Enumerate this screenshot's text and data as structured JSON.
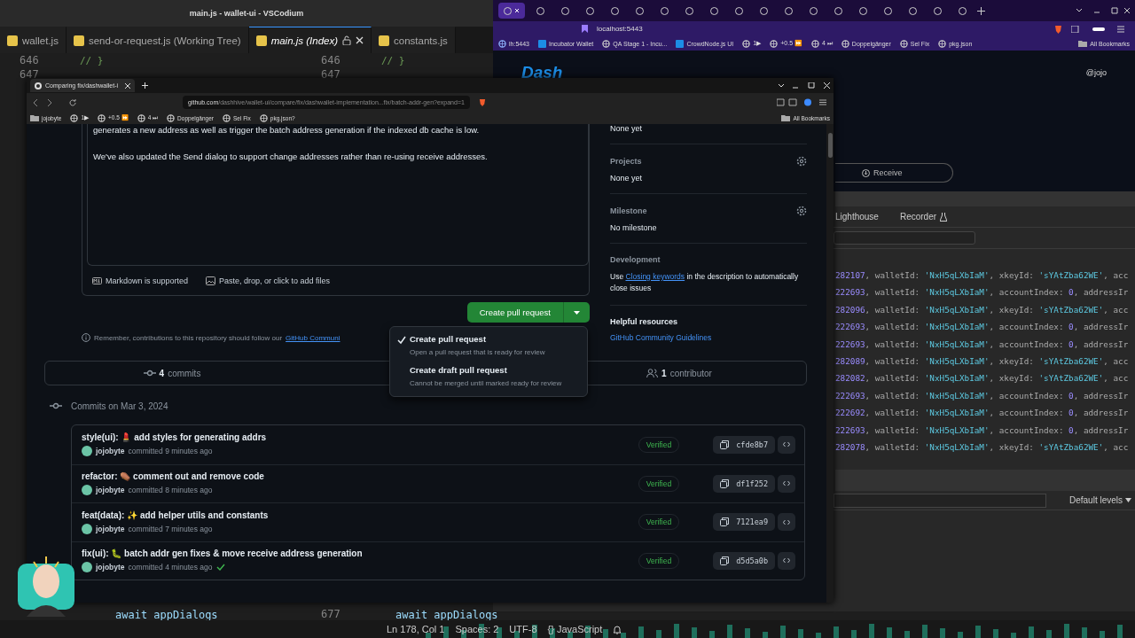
{
  "editor": {
    "title": "main.js - wallet-ui - VSCodium",
    "tabs": [
      {
        "label": "wallet.js",
        "selected": false
      },
      {
        "label": "send-or-request.js (Working Tree)",
        "selected": false
      },
      {
        "label": "main.js (Index)",
        "selected": true
      },
      {
        "label": "constants.js",
        "selected": false
      }
    ],
    "panes": [
      {
        "top_lines": [
          {
            "number": "646",
            "code": "// }"
          },
          {
            "number": "647"
          }
        ],
        "bottom_code": "await appDialogs"
      },
      {
        "top_lines": [
          {
            "number": "646",
            "code": "// }"
          },
          {
            "number": "647"
          }
        ],
        "bottom_number": "677",
        "bottom_code": "await appDialogs"
      }
    ],
    "status": [
      "Ln 178, Col 1",
      "Spaces: 2",
      "UTF-8",
      "{} JavaScript"
    ]
  },
  "brave": {
    "tabs": [
      {
        "selected": true
      },
      {
        "selected": false
      },
      {
        "selected": false
      },
      {
        "selected": false
      },
      {
        "selected": false
      },
      {
        "selected": false
      },
      {
        "selected": false
      },
      {
        "selected": false
      },
      {
        "selected": false
      },
      {
        "selected": false
      },
      {
        "selected": false
      },
      {
        "selected": false
      },
      {
        "selected": false
      },
      {
        "selected": false
      },
      {
        "selected": false
      },
      {
        "selected": false
      },
      {
        "selected": false
      },
      {
        "selected": false
      },
      {
        "selected": false
      }
    ],
    "url": "localhost:5443",
    "bookmarks": [
      {
        "label": "lh:5443",
        "kind": "site"
      },
      {
        "label": "Incubator Wallet",
        "kind": "app"
      },
      {
        "label": "QA Stage 1 - Incu...",
        "kind": "globe"
      },
      {
        "label": "CrowdNode.js UI",
        "kind": "app"
      },
      {
        "label": "1▶",
        "kind": "globe"
      },
      {
        "label": "+0.5 ⏩",
        "kind": "globe"
      },
      {
        "label": "4 ⏭",
        "kind": "globe"
      },
      {
        "label": "Doppelgänger",
        "kind": "globe"
      },
      {
        "label": "Sel Fix",
        "kind": "globe"
      },
      {
        "label": "pkg.json",
        "kind": "globe"
      }
    ],
    "all_bookmarks": "All Bookmarks",
    "page": {
      "logo": "Dash",
      "user": "@jojo",
      "receive": "Receive"
    },
    "devtools": {
      "tabs": [
        "Lighthouse",
        "Recorder"
      ],
      "console": [
        [
          {
            "text": "282107",
            "kind": "number"
          },
          {
            "text": ", walletId: ",
            "kind": "plain"
          },
          {
            "text": "'NxH5qLXbIaM'",
            "kind": "string"
          },
          {
            "text": ", xkeyId: ",
            "kind": "plain"
          },
          {
            "text": "'sYAtZba62WE'",
            "kind": "string"
          },
          {
            "text": ", acc",
            "kind": "plain"
          }
        ],
        [
          {
            "text": "222693",
            "kind": "number"
          },
          {
            "text": ", walletId: ",
            "kind": "plain"
          },
          {
            "text": "'NxH5qLXbIaM'",
            "kind": "string"
          },
          {
            "text": ", accountIndex: ",
            "kind": "plain"
          },
          {
            "text": "0",
            "kind": "number"
          },
          {
            "text": ", addressIr",
            "kind": "plain"
          }
        ],
        [
          {
            "text": "282096",
            "kind": "number"
          },
          {
            "text": ", walletId: ",
            "kind": "plain"
          },
          {
            "text": "'NxH5qLXbIaM'",
            "kind": "string"
          },
          {
            "text": ", xkeyId: ",
            "kind": "plain"
          },
          {
            "text": "'sYAtZba62WE'",
            "kind": "string"
          },
          {
            "text": ", acc",
            "kind": "plain"
          }
        ],
        [
          {
            "text": "222693",
            "kind": "number"
          },
          {
            "text": ", walletId: ",
            "kind": "plain"
          },
          {
            "text": "'NxH5qLXbIaM'",
            "kind": "string"
          },
          {
            "text": ", accountIndex: ",
            "kind": "plain"
          },
          {
            "text": "0",
            "kind": "number"
          },
          {
            "text": ", addressIr",
            "kind": "plain"
          }
        ],
        [
          {
            "text": "222693",
            "kind": "number"
          },
          {
            "text": ", walletId: ",
            "kind": "plain"
          },
          {
            "text": "'NxH5qLXbIaM'",
            "kind": "string"
          },
          {
            "text": ", accountIndex: ",
            "kind": "plain"
          },
          {
            "text": "0",
            "kind": "number"
          },
          {
            "text": ", addressIr",
            "kind": "plain"
          }
        ],
        [
          {
            "text": "282089",
            "kind": "number"
          },
          {
            "text": ", walletId: ",
            "kind": "plain"
          },
          {
            "text": "'NxH5qLXbIaM'",
            "kind": "string"
          },
          {
            "text": ", xkeyId: ",
            "kind": "plain"
          },
          {
            "text": "'sYAtZba62WE'",
            "kind": "string"
          },
          {
            "text": ", acc",
            "kind": "plain"
          }
        ],
        [
          {
            "text": "282082",
            "kind": "number"
          },
          {
            "text": ", walletId: ",
            "kind": "plain"
          },
          {
            "text": "'NxH5qLXbIaM'",
            "kind": "string"
          },
          {
            "text": ", xkeyId: ",
            "kind": "plain"
          },
          {
            "text": "'sYAtZba62WE'",
            "kind": "string"
          },
          {
            "text": ", acc",
            "kind": "plain"
          }
        ],
        [
          {
            "text": "222693",
            "kind": "number"
          },
          {
            "text": ", walletId: ",
            "kind": "plain"
          },
          {
            "text": "'NxH5qLXbIaM'",
            "kind": "string"
          },
          {
            "text": ", accountIndex: ",
            "kind": "plain"
          },
          {
            "text": "0",
            "kind": "number"
          },
          {
            "text": ", addressIr",
            "kind": "plain"
          }
        ],
        [
          {
            "text": "222692",
            "kind": "number"
          },
          {
            "text": ", walletId: ",
            "kind": "plain"
          },
          {
            "text": "'NxH5qLXbIaM'",
            "kind": "string"
          },
          {
            "text": ", accountIndex: ",
            "kind": "plain"
          },
          {
            "text": "0",
            "kind": "number"
          },
          {
            "text": ", addressIr",
            "kind": "plain"
          }
        ],
        [
          {
            "text": "222693",
            "kind": "number"
          },
          {
            "text": ", walletId: ",
            "kind": "plain"
          },
          {
            "text": "'NxH5qLXbIaM'",
            "kind": "string"
          },
          {
            "text": ", accountIndex: ",
            "kind": "plain"
          },
          {
            "text": "0",
            "kind": "number"
          },
          {
            "text": ", addressIr",
            "kind": "plain"
          }
        ],
        [
          {
            "text": "282078",
            "kind": "number"
          },
          {
            "text": ", walletId: ",
            "kind": "plain"
          },
          {
            "text": "'NxH5qLXbIaM'",
            "kind": "string"
          },
          {
            "text": ", xkeyId: ",
            "kind": "plain"
          },
          {
            "text": "'sYAtZba62WE'",
            "kind": "string"
          },
          {
            "text": ", acc",
            "kind": "plain"
          }
        ]
      ],
      "levels": "Default levels"
    }
  },
  "github": {
    "tab_title": "Comparing fix/dashwallet-i",
    "url_host": "github.com",
    "url_path": "/dashhive/wallet-ui/compare/fix/dashwallet-implementation...fix/batch-addr-gen?expand=1",
    "bookmarks": [
      {
        "label": "jojobyte",
        "kind": "folder"
      },
      {
        "label": "1▶",
        "kind": "globe"
      },
      {
        "label": "+0.5 ⏩",
        "kind": "globe"
      },
      {
        "label": "4 ⏭",
        "kind": "globe"
      },
      {
        "label": "Doppelgänger",
        "kind": "globe"
      },
      {
        "label": "Sel Fix",
        "kind": "globe"
      },
      {
        "label": "pkg.json?",
        "kind": "globe"
      }
    ],
    "all_bookmarks": "All Bookmarks",
    "description": [
      "generates a new address as well as trigger the batch address generation if the indexed db cache is low.",
      "We've also updated the Send dialog to support change addresses rather than re-using receive addresses."
    ],
    "markdown_note": "Markdown is supported",
    "attach_note": "Paste, drop, or click to add files",
    "create_button": "Create pull request",
    "menu": [
      {
        "title": "Create pull request",
        "description": "Open a pull request that is ready for review",
        "selected": true
      },
      {
        "title": "Create draft pull request",
        "description": "Cannot be merged until marked ready for review",
        "selected": false
      }
    ],
    "note": "Remember, contributions to this repository should follow our",
    "note_link": "GitHub Communi",
    "stats": [
      {
        "count": "4",
        "label": "commits",
        "kind": "commits"
      },
      {
        "count": "1",
        "label": "contributor",
        "kind": "contributors"
      }
    ],
    "commits_date": "Commits on Mar 3, 2024",
    "commits": [
      {
        "title": "style(ui): 💄 add styles for generating addrs",
        "author": "jojobyte",
        "time": "committed 9 minutes ago",
        "badge": "Verified",
        "sha": "cfde8b7",
        "checked": false
      },
      {
        "title": "refactor: ⚰️ comment out and remove code",
        "author": "jojobyte",
        "time": "committed 8 minutes ago",
        "badge": "Verified",
        "sha": "df1f252",
        "checked": false
      },
      {
        "title": "feat(data): ✨ add helper utils and constants",
        "author": "jojobyte",
        "time": "committed 7 minutes ago",
        "badge": "Verified",
        "sha": "7121ea9",
        "checked": false
      },
      {
        "title": "fix(ui): 🐛 batch addr gen fixes & move receive address generation",
        "author": "jojobyte",
        "time": "committed 4 minutes ago",
        "badge": "Verified",
        "sha": "d5d5a0b",
        "checked": true
      }
    ],
    "sidebar": {
      "top_value": "None yet",
      "sections": [
        {
          "heading": "Projects",
          "value": "None yet",
          "kind": "setting"
        },
        {
          "heading": "Milestone",
          "value": "No milestone",
          "kind": "setting"
        }
      ],
      "development": {
        "heading": "Development",
        "before": "Use ",
        "link": "Closing keywords",
        "after": " in the description to automatically close issues"
      },
      "resources": {
        "heading": "Helpful resources",
        "link": "GitHub Community Guidelines"
      }
    }
  }
}
